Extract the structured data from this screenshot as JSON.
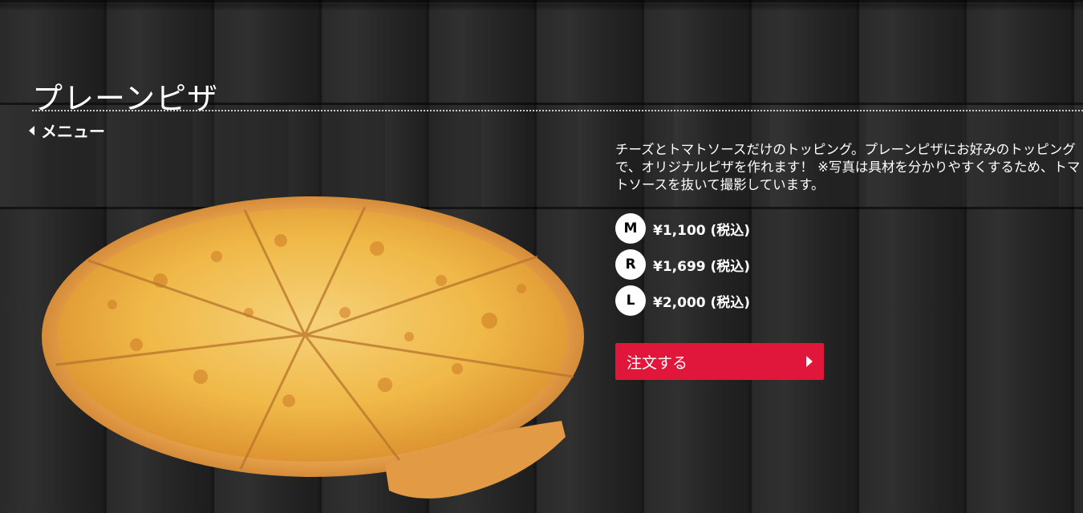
{
  "product": {
    "title": "プレーンピザ",
    "back_link_label": "メニュー",
    "description": "チーズとトマトソースだけのトッピング。プレーンピザにお好みのトッピングで、オリジナルピザを作れます！ ※写真は具材を分かりやすくするため、トマトソースを抜いて撮影しています。",
    "image_alt": "プレーンピザ"
  },
  "sizes": [
    {
      "code": "M",
      "price": "¥1,100 (税込)"
    },
    {
      "code": "R",
      "price": "¥1,699 (税込)"
    },
    {
      "code": "L",
      "price": "¥2,000 (税込)"
    }
  ],
  "order": {
    "button_label": "注文する"
  },
  "colors": {
    "accent": "#e0173a",
    "background": "#262626",
    "text": "#ffffff"
  },
  "icons": {
    "back": "caret-left-icon",
    "order": "caret-right-icon"
  }
}
